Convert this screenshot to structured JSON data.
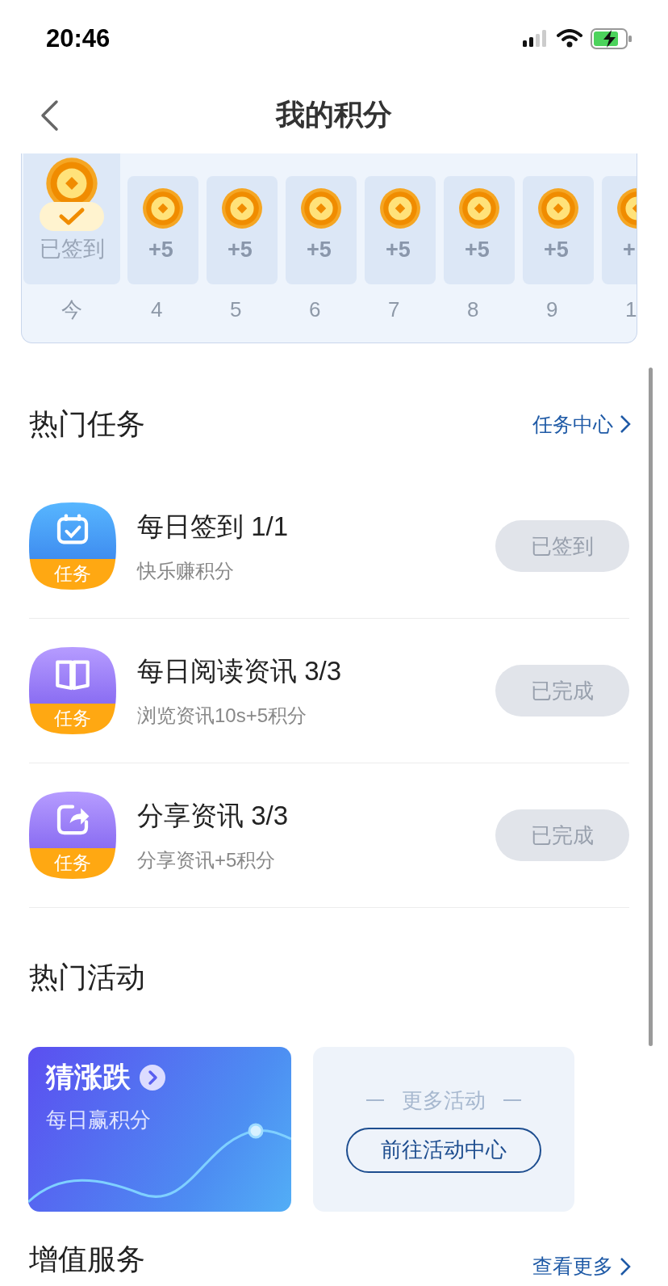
{
  "status_bar": {
    "time": "20:46"
  },
  "nav": {
    "title": "我的积分"
  },
  "checkin": {
    "days": [
      {
        "day": "今",
        "reward": "已签到",
        "signed": true
      },
      {
        "day": "4",
        "reward": "+5",
        "signed": false
      },
      {
        "day": "5",
        "reward": "+5",
        "signed": false
      },
      {
        "day": "6",
        "reward": "+5",
        "signed": false
      },
      {
        "day": "7",
        "reward": "+5",
        "signed": false
      },
      {
        "day": "8",
        "reward": "+5",
        "signed": false
      },
      {
        "day": "9",
        "reward": "+5",
        "signed": false
      },
      {
        "day": "1",
        "reward": "+",
        "signed": false
      }
    ]
  },
  "hot_tasks": {
    "title": "热门任务",
    "link": "任务中心",
    "tasks": [
      {
        "kind": "calendar",
        "badge": "任务",
        "title": "每日签到 1/1",
        "subtitle": "快乐赚积分",
        "button": "已签到",
        "disabled": true
      },
      {
        "kind": "book",
        "badge": "任务",
        "title": "每日阅读资讯 3/3",
        "subtitle": "浏览资讯10s+5积分",
        "button": "已完成",
        "disabled": true
      },
      {
        "kind": "share",
        "badge": "任务",
        "title": "分享资讯 3/3",
        "subtitle": "分享资讯+5积分",
        "button": "已完成",
        "disabled": true
      }
    ]
  },
  "hot_activities": {
    "title": "热门活动",
    "cards": [
      {
        "kind": "promo",
        "title": "猜涨跌",
        "subtitle": "每日赢积分"
      },
      {
        "kind": "more",
        "title": "更多活动",
        "button": "前往活动中心"
      }
    ]
  },
  "value_added": {
    "title": "增值服务",
    "link": "查看更多"
  }
}
